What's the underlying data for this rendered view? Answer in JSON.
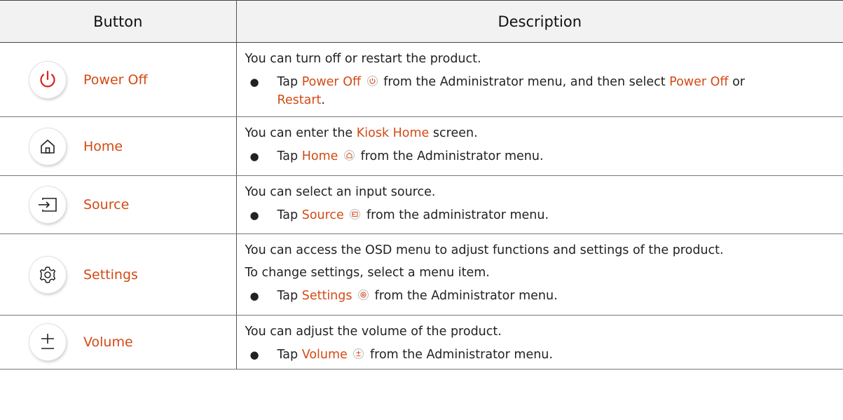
{
  "header": {
    "col1": "Button",
    "col2": "Description"
  },
  "common": {
    "tap": "Tap",
    "from_admin": "from the Administrator menu.",
    "from_admin_lower": "from the administrator menu."
  },
  "rows": [
    {
      "label": "Power Off",
      "icon": "power-icon",
      "intro": "You can turn off or restart the product.",
      "bullet_mid": "from the Administrator menu, and then select",
      "bullet_opt1": "Power Off",
      "bullet_or": "or",
      "bullet_opt2": "Restart"
    },
    {
      "label": "Home",
      "icon": "home-icon",
      "intro_pre": "You can enter the",
      "intro_hl": "Kiosk Home",
      "intro_post": "screen."
    },
    {
      "label": "Source",
      "icon": "source-icon",
      "intro": "You can select an input source."
    },
    {
      "label": "Settings",
      "icon": "gear-icon",
      "intro": "You can access the OSD menu to adjust functions and settings of the product.",
      "intro2": "To change settings, select a menu item."
    },
    {
      "label": "Volume",
      "icon": "volume-icon",
      "intro": "You can adjust the volume of the product."
    }
  ],
  "colors": {
    "accent": "#d34a14",
    "header_bg": "#f2f2f2"
  }
}
